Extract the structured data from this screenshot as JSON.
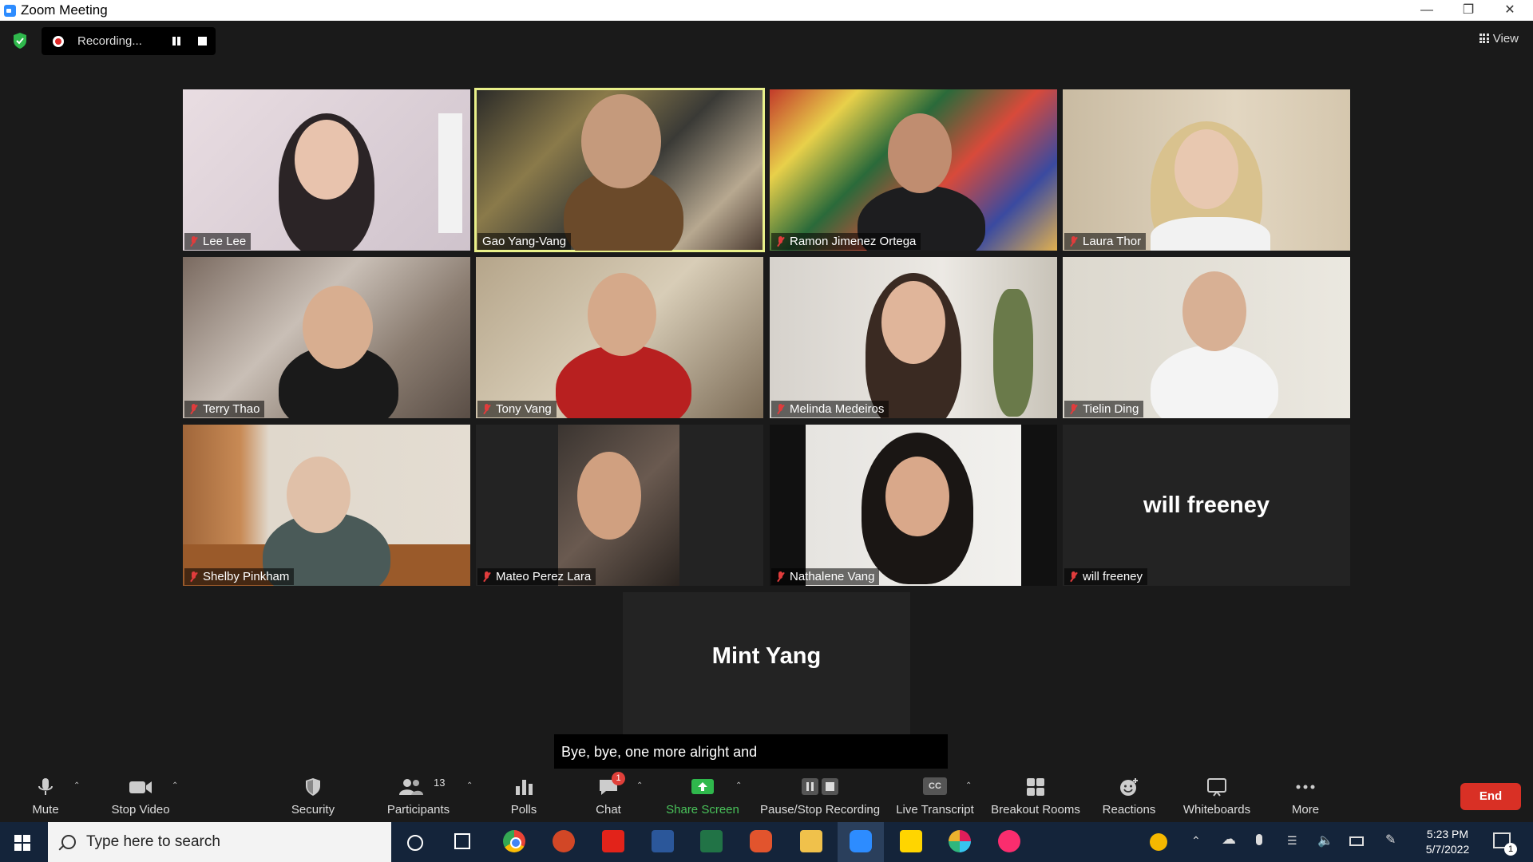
{
  "window": {
    "title": "Zoom Meeting"
  },
  "recording": {
    "label": "Recording..."
  },
  "view": {
    "label": "View"
  },
  "tiles": [
    {
      "name": "Lee Lee"
    },
    {
      "name": "Gao Yang-Vang"
    },
    {
      "name": "Ramon Jimenez Ortega"
    },
    {
      "name": "Laura Thor"
    },
    {
      "name": "Terry Thao"
    },
    {
      "name": "Tony Vang"
    },
    {
      "name": "Melinda Medeiros"
    },
    {
      "name": "Tielin Ding"
    },
    {
      "name": "Shelby Pinkham"
    },
    {
      "name": "Mateo Perez Lara"
    },
    {
      "name": "Nathalene Vang"
    },
    {
      "name": "will freeney",
      "display_name": "will freeney"
    }
  ],
  "bottom_tile": {
    "display_name": "Mint Yang"
  },
  "caption": {
    "text": "Bye, bye, one more alright and"
  },
  "toolbar": {
    "mute": "Mute",
    "stop_video": "Stop Video",
    "security": "Security",
    "participants": "Participants",
    "participants_count": "13",
    "polls": "Polls",
    "chat": "Chat",
    "chat_badge": "1",
    "share_screen": "Share Screen",
    "pause_stop_recording": "Pause/Stop Recording",
    "live_transcript": "Live Transcript",
    "live_transcript_icon": "CC",
    "breakout_rooms": "Breakout Rooms",
    "reactions": "Reactions",
    "whiteboards": "Whiteboards",
    "more": "More",
    "end": "End"
  },
  "taskbar": {
    "search_placeholder": "Type here to search",
    "time": "5:23 PM",
    "date": "5/7/2022",
    "notification_count": "1"
  },
  "colors": {
    "active_speaker_border": "#e9f08a",
    "end_button": "#d93025",
    "share_screen": "#49c25a",
    "muted_mic": "#e03c3c"
  }
}
